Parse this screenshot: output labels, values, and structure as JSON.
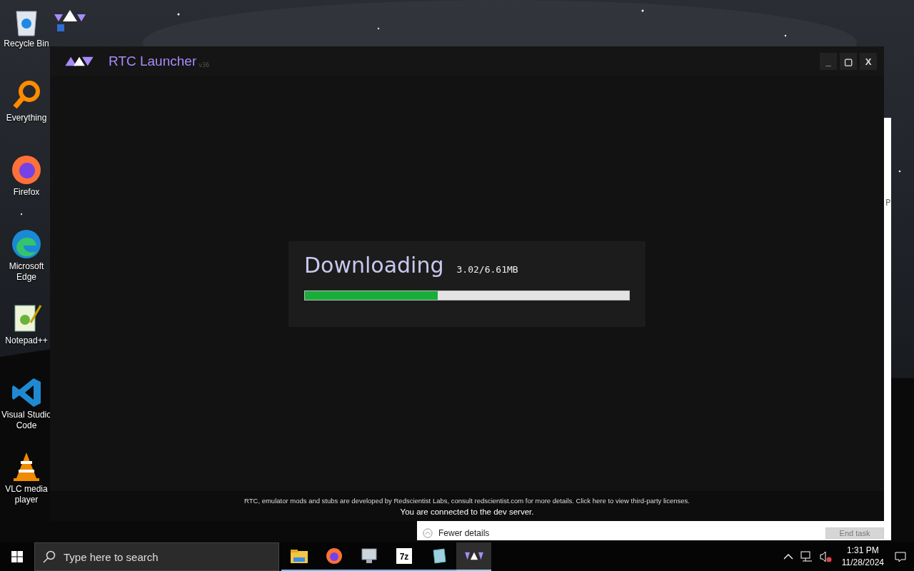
{
  "desktop": {
    "icons": [
      {
        "kind": "recycle",
        "label": "Recycle Bin"
      },
      {
        "kind": "rtc"
      },
      {
        "kind": "everything",
        "label": "Everything"
      },
      {
        "kind": "firefox",
        "label": "Firefox"
      },
      {
        "kind": "edge",
        "label": "Microsoft Edge"
      },
      {
        "kind": "notepad",
        "label": "Notepad++"
      },
      {
        "kind": "vscode",
        "label": "Visual Studio Code"
      },
      {
        "kind": "vlc",
        "label": "VLC media player"
      }
    ]
  },
  "task_manager": {
    "column_header": "P",
    "fewer_details": "Fewer details",
    "end_task": {
      "label": "End task",
      "disabled": true
    }
  },
  "launcher": {
    "title": "RTC Launcher",
    "version": "v36",
    "controls": [
      "_",
      "▢",
      "X"
    ],
    "download": {
      "title": "Downloading",
      "progress_text": "3.02/6.61MB",
      "level": 0.41
    },
    "footer": {
      "notice": "RTC, emulator mods and stubs are developed by Redscientist Labs, consult redscientist.com for more details. Click here to view third-party licenses.",
      "status": "You are connected to the dev server."
    }
  },
  "taskbar": {
    "search": {
      "placeholder": "Type here to search"
    },
    "apps": [
      {
        "kind": "folder",
        "active": false
      },
      {
        "kind": "firefox",
        "active": false
      },
      {
        "kind": "monitor",
        "active": false
      },
      {
        "kind": "sevenzip",
        "label": "7z",
        "active": false
      },
      {
        "kind": "notepad",
        "active": false
      },
      {
        "kind": "rtc",
        "active": true
      }
    ],
    "tray": {
      "time": "1:31 PM",
      "date": "11/28/2024",
      "volume_muted": true
    }
  }
}
